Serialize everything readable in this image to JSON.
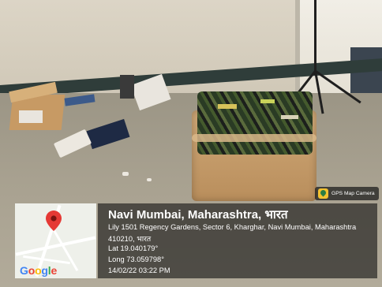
{
  "overlay": {
    "badge": {
      "icon": "gps-map-camera-icon",
      "text": "GPS Map Camera"
    },
    "map": {
      "logo": "Google",
      "pin_icon": "location-pin-icon"
    },
    "location": {
      "title": "Navi Mumbai, Maharashtra, भारत",
      "address_line1": "Lily 1501 Regency Gardens, Sector 6, Kharghar, Navi Mumbai, Maharashtra",
      "address_line2": "410210, भारत",
      "lat": "Lat 19.040179°",
      "long": "Long 73.059798°",
      "datetime": "14/02/22 03:22 PM"
    }
  },
  "colors": {
    "overlay_bg": "#141414",
    "pin": "#e53935",
    "google_blue": "#4285f4",
    "google_red": "#ea4335",
    "google_yellow": "#fbbc05",
    "google_green": "#34a853"
  }
}
